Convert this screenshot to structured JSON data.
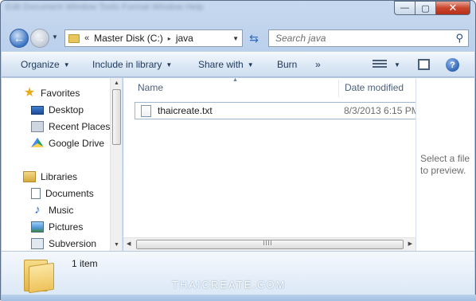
{
  "title_bar": {
    "ghost_text": "Edit   Document   Window   Tools   Format   Window   Help",
    "minimize_label": "—",
    "maximize_label": "▢",
    "close_label": "✕"
  },
  "address_bar": {
    "overflow": "«",
    "segments": [
      "Master Disk (C:)",
      "java"
    ],
    "separator": "▸"
  },
  "search": {
    "placeholder": "Search java"
  },
  "toolbar": {
    "organize": "Organize",
    "include_in_library": "Include in library",
    "share_with": "Share with",
    "burn": "Burn",
    "more": "»",
    "help": "?"
  },
  "navigation": {
    "favorites_header": "Favorites",
    "favorites": [
      "Desktop",
      "Recent Places",
      "Google Drive"
    ],
    "libraries_header": "Libraries",
    "libraries": [
      "Documents",
      "Music",
      "Pictures",
      "Subversion"
    ]
  },
  "file_list": {
    "columns": [
      "Name",
      "Date modified"
    ],
    "rows": [
      {
        "name": "thaicreate.txt",
        "date_modified": "8/3/2013 6:15 PM"
      }
    ]
  },
  "preview_pane": {
    "message": "Select a file to preview."
  },
  "details_pane": {
    "item_count": "1 item"
  },
  "watermark": "THAICREATE.COM",
  "colors": {
    "accent": "#2a5fb0",
    "command_text": "#1e395b",
    "folder": "#eec35c"
  }
}
